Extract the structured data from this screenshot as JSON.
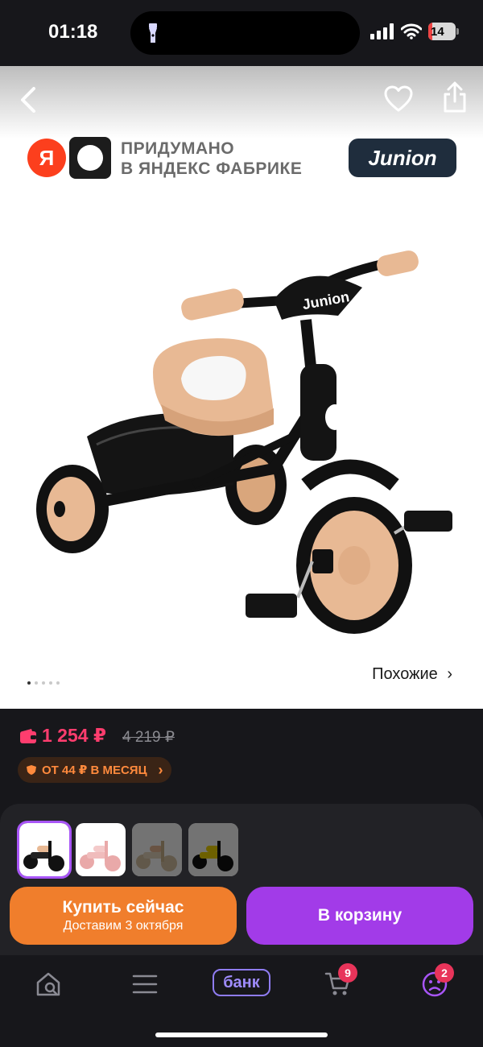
{
  "status_bar": {
    "time": "01:18",
    "battery": "14",
    "icons": [
      "flashlight-icon",
      "signal-icon",
      "wifi-icon",
      "battery-icon"
    ]
  },
  "header": {
    "icons": [
      "back-arrow-icon",
      "heart-icon",
      "share-icon"
    ]
  },
  "banner": {
    "ya_letter": "Я",
    "factory_line1": "ПРИДУМАНО",
    "factory_line2": "В ЯНДЕКС ФАБРИКЕ",
    "brand": "Junion"
  },
  "gallery": {
    "current_index": 1,
    "total_dots": 5,
    "similar_label": "Похожие",
    "similar_chevron": "›"
  },
  "price": {
    "current": "1 254 ₽",
    "old": "4 219 ₽",
    "installment": "ОТ 44 ₽ В МЕСЯЦ",
    "installment_chevron": "›",
    "colors": {
      "current": "#ff3d6e",
      "installment": "#ff8a3d"
    }
  },
  "variants": [
    {
      "name": "black",
      "selected": true
    },
    {
      "name": "pink",
      "selected": false
    },
    {
      "name": "beige",
      "selected": false
    },
    {
      "name": "yellow",
      "selected": false
    }
  ],
  "actions": {
    "buy_now": "Купить сейчас",
    "delivery": "Доставим 3 октября",
    "add_to_cart": "В корзину",
    "colors": {
      "buy_now": "#f07e2c",
      "add_to_cart": "#a23be8"
    }
  },
  "bottom_nav": {
    "bank_label": "банк",
    "cart_badge": "9",
    "profile_badge": "2",
    "items": [
      "home-search-icon",
      "menu-icon",
      "bank-label",
      "cart-icon",
      "profile-icon"
    ]
  }
}
